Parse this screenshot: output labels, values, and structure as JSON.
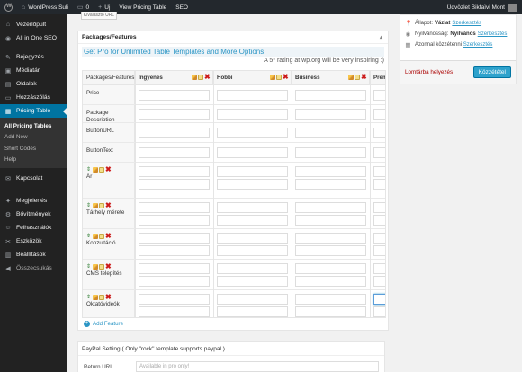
{
  "adminbar": {
    "site_name": "WordPress Suli",
    "comments_count": "0",
    "new_label": "Új",
    "view_label": "View Pricing Table",
    "seo_label": "SEO",
    "greeting": "Üdvözlet Bikfaìvi Mont"
  },
  "sidebar": {
    "items": [
      {
        "label": "Vezérlőpult",
        "icon": "dashboard-icon",
        "glyph": "⌂"
      },
      {
        "label": "All in One SEO",
        "icon": "seo-icon",
        "glyph": "◉"
      },
      {
        "label": "Bejegyzés",
        "icon": "pin-icon",
        "glyph": "✎"
      },
      {
        "label": "Médiatár",
        "icon": "media-icon",
        "glyph": "▣"
      },
      {
        "label": "Oldalak",
        "icon": "pages-icon",
        "glyph": "▤"
      },
      {
        "label": "Hozzászólás",
        "icon": "comments-icon",
        "glyph": "▭"
      },
      {
        "label": "Pricing Table",
        "icon": "pricing-table-icon",
        "glyph": "▦"
      },
      {
        "label": "Kapcsolat",
        "icon": "contact-icon",
        "glyph": "✉"
      },
      {
        "label": "Megjelenés",
        "icon": "appearance-icon",
        "glyph": "✦"
      },
      {
        "label": "Bővítmények",
        "icon": "plugins-icon",
        "glyph": "⚙"
      },
      {
        "label": "Felhasználók",
        "icon": "users-icon",
        "glyph": "☺"
      },
      {
        "label": "Eszközök",
        "icon": "tools-icon",
        "glyph": "✂"
      },
      {
        "label": "Beállítások",
        "icon": "settings-icon",
        "glyph": "▥"
      },
      {
        "label": "Összecsukás",
        "icon": "collapse-icon",
        "glyph": "◀"
      }
    ],
    "submenu": [
      "All Pricing Tables",
      "Add New",
      "Short Codes",
      "Help"
    ]
  },
  "main": {
    "top_stub": "Kiválasztó URL",
    "box_title": "Packages/Features",
    "promo": "Get Pro for Unlimited Table Templates and More Options",
    "rating": "A 5* rating at wp.org will be very inspiring :)",
    "columns": [
      "Packages/Features",
      "Ingyenes",
      "Hobbi",
      "Business",
      "Prem"
    ],
    "rows": [
      {
        "label": "Price",
        "tools": false
      },
      {
        "label": "Package Description",
        "tools": false
      },
      {
        "label": "ButtonURL",
        "tools": false
      },
      {
        "label": "ButtonText",
        "tools": false
      },
      {
        "label": "Ár",
        "tools": true
      },
      {
        "label": "Tárhely mérete",
        "tools": true
      },
      {
        "label": "Konzultáció",
        "tools": true
      },
      {
        "label": "CMS telepítés",
        "tools": true
      },
      {
        "label": "Oktatóvideók",
        "tools": true
      }
    ],
    "add_feature": "Add Feature",
    "paypal_title": "PayPal Setting ( Only \"rock\" template supports paypal )",
    "return_url_label": "Return URL",
    "return_url_placeholder": "Available in pro only!"
  },
  "publish": {
    "status_label": "Állapot:",
    "status_value": "Vázlat",
    "visibility_label": "Nyilvánosság:",
    "visibility_value": "Nyilvános",
    "publish_label": "Azonnal közzétenni",
    "edit": "Szerkesztés",
    "trash": "Lomtárba helyezés",
    "publish_button": "Közzététel"
  }
}
